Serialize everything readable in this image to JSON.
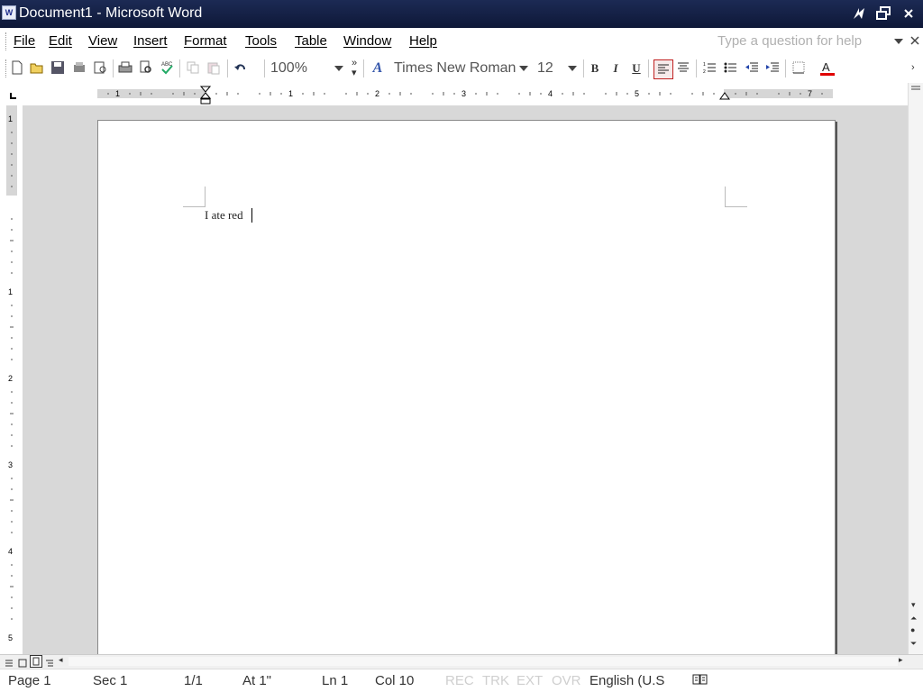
{
  "window": {
    "title": "Document1 - Microsoft Word",
    "app_icon": "W"
  },
  "menu": {
    "items": [
      "File",
      "Edit",
      "View",
      "Insert",
      "Format",
      "Tools",
      "Table",
      "Window",
      "Help"
    ],
    "help_placeholder": "Type a question for help"
  },
  "toolbar": {
    "zoom": "100%",
    "font": "Times New Roman",
    "size": "12",
    "bold": "B",
    "italic": "I",
    "underline": "U"
  },
  "ruler": {
    "numbers": [
      "1",
      "1",
      "2",
      "3",
      "4",
      "5",
      "7"
    ],
    "vertical_numbers": [
      "1",
      "1",
      "2",
      "3",
      "4",
      "5"
    ]
  },
  "document": {
    "text": "I ate red"
  },
  "status": {
    "page": "Page 1",
    "sec": "Sec 1",
    "pages": "1/1",
    "at": "At 1\"",
    "ln": "Ln 1",
    "col": "Col 10",
    "rec": "REC",
    "trk": "TRK",
    "ext": "EXT",
    "ovr": "OVR",
    "language": "English (U.S"
  },
  "colors": {
    "title_bar": "#1c2a54",
    "font_color": "#e00000",
    "active_button_border": "#c02020"
  },
  "icons": [
    "word-app-icon",
    "new-document-icon",
    "open-icon",
    "save-icon",
    "permission-icon",
    "print-preview-icon",
    "print-icon",
    "print-preview-magnifier-icon",
    "spelling-icon",
    "copy-icon",
    "paste-icon",
    "undo-icon",
    "styles-icon",
    "bold-icon",
    "italic-icon",
    "underline-icon",
    "align-left-icon",
    "center-icon",
    "numbering-icon",
    "bullets-icon",
    "decrease-indent-icon",
    "increase-indent-icon",
    "border-icon",
    "font-color-icon",
    "spelling-status-icon"
  ]
}
